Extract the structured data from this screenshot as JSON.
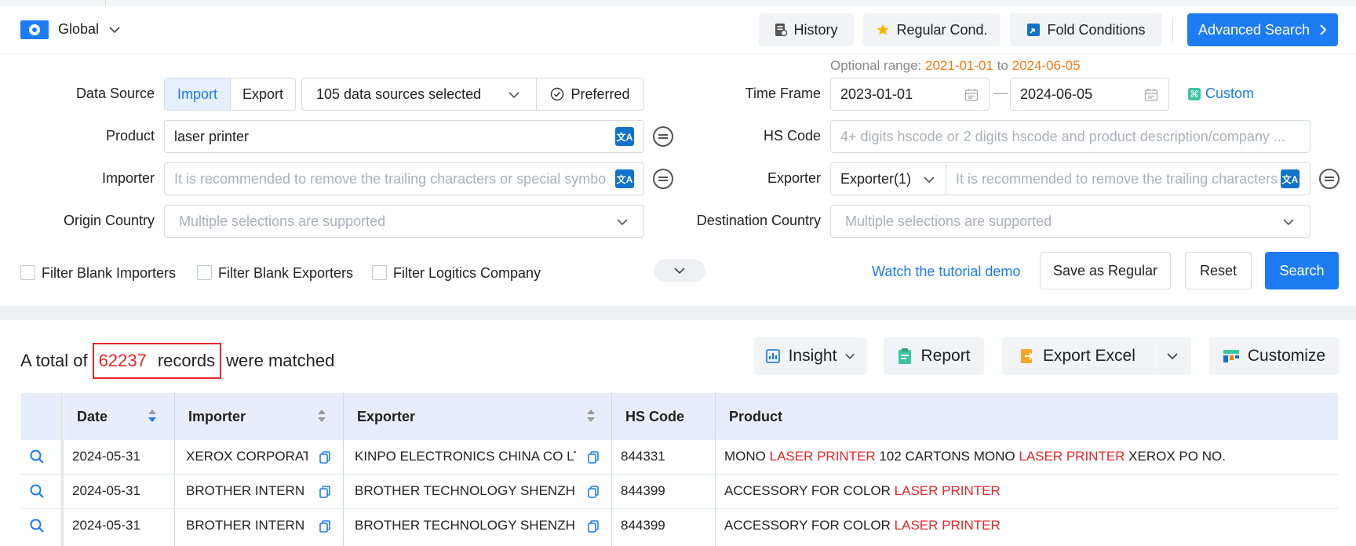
{
  "topbar": {
    "region_label": "Global",
    "history_label": "History",
    "regular_label": "Regular Cond.",
    "fold_label": "Fold Conditions",
    "advanced_label": "Advanced Search"
  },
  "form": {
    "optional_range_label": "Optional range:",
    "optional_from": "2021-01-01",
    "optional_to_word": "to",
    "optional_to": "2024-06-05",
    "data_source_label": "Data Source",
    "import_label": "Import",
    "export_label": "Export",
    "sources_selected": "105 data sources selected",
    "preferred_label": "Preferred",
    "time_frame_label": "Time Frame",
    "date_from": "2023-01-01",
    "date_to": "2024-06-05",
    "date_dash": "—",
    "custom_label": "Custom",
    "product_label": "Product",
    "product_value": "laser printer",
    "hs_code_label": "HS Code",
    "hs_code_placeholder": "4+ digits hscode or 2 digits hscode and product description/company ...",
    "importer_label": "Importer",
    "importer_placeholder": "It is recommended to remove the trailing characters or special symbo",
    "exporter_label": "Exporter",
    "exporter_select": "Exporter(1)",
    "exporter_placeholder": "It is recommended to remove the trailing characters",
    "origin_label": "Origin Country",
    "origin_placeholder": "Multiple selections are supported",
    "destination_label": "Destination Country",
    "destination_placeholder": "Multiple selections are supported",
    "filter_importers": "Filter Blank Importers",
    "filter_exporters": "Filter Blank Exporters",
    "filter_logistics": "Filter Logitics Company",
    "tutorial_link": "Watch the tutorial demo",
    "save_regular": "Save as Regular",
    "reset": "Reset",
    "search": "Search",
    "translate_glyph": "文A"
  },
  "results": {
    "prefix": "A total of",
    "count": "62237",
    "records_word": "records",
    "suffix": "were matched",
    "insight_label": "Insight",
    "report_label": "Report",
    "export_excel_label": "Export Excel",
    "customize_label": "Customize"
  },
  "table": {
    "columns": [
      "Date",
      "Importer",
      "Exporter",
      "HS Code",
      "Product"
    ],
    "rows": [
      {
        "date": "2024-05-31",
        "importer": "XEROX CORPORAT",
        "exporter": "KINPO ELECTRONICS CHINA CO LT",
        "hs": "844331",
        "p1": "MONO ",
        "p2": "LASER PRINTER",
        "p3": " 102 CARTONS MONO ",
        "p4": "LASER PRINTER",
        "p5": " XEROX PO NO."
      },
      {
        "date": "2024-05-31",
        "importer": "BROTHER INTERN",
        "exporter": "BROTHER TECHNOLOGY SHENZH",
        "hs": "844399",
        "p1": "ACCESSORY FOR COLOR ",
        "p2": "LASER PRINTER"
      },
      {
        "date": "2024-05-31",
        "importer": "BROTHER INTERN",
        "exporter": "BROTHER TECHNOLOGY SHENZH",
        "hs": "844399",
        "p1": "ACCESSORY FOR COLOR ",
        "p2": "LASER PRINTER"
      }
    ]
  },
  "colors": {
    "accent": "#1d7cf2",
    "highlight": "#e8262a",
    "date_orange": "#f07b16"
  }
}
